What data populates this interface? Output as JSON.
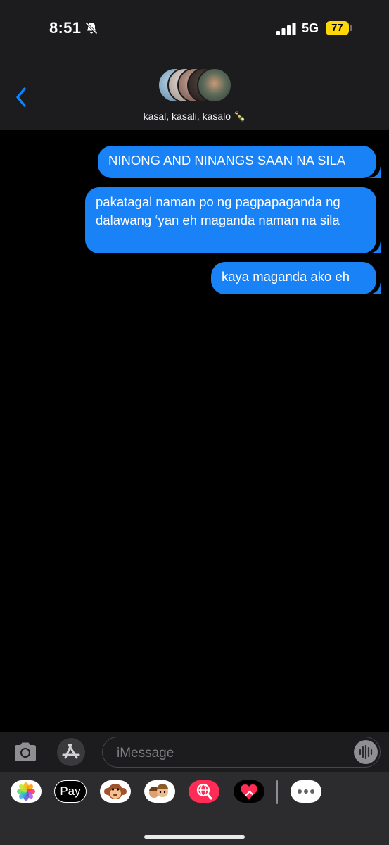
{
  "status_bar": {
    "time": "8:51",
    "network": "5G",
    "battery": "77"
  },
  "conversation": {
    "name": "kasal, kasali, kasalo 🍾",
    "participants": [
      "avatar-1",
      "avatar-2",
      "avatar-3",
      "avatar-4",
      "avatar-5"
    ]
  },
  "messages": [
    {
      "text": "NINONG AND NINANGS SAAN NA SILA",
      "sender": "me"
    },
    {
      "text": "pakatagal naman po ng pagpapaganda ng dalawang ‘yan eh maganda naman na sila",
      "sender": "me"
    },
    {
      "text": "kaya maganda ako eh",
      "sender": "me"
    }
  ],
  "input": {
    "placeholder": "iMessage"
  },
  "app_drawer": {
    "apple_pay_label": "Pay",
    "apps": [
      "photos-icon",
      "apple-pay-icon",
      "animoji-icon",
      "memoji-icon",
      "search-images-icon",
      "digital-touch-icon",
      "more-icon"
    ]
  },
  "colors": {
    "bubble": "#1a82f7",
    "accent": "#0a84ff",
    "battery": "#ffd60a",
    "background": "#000000"
  }
}
